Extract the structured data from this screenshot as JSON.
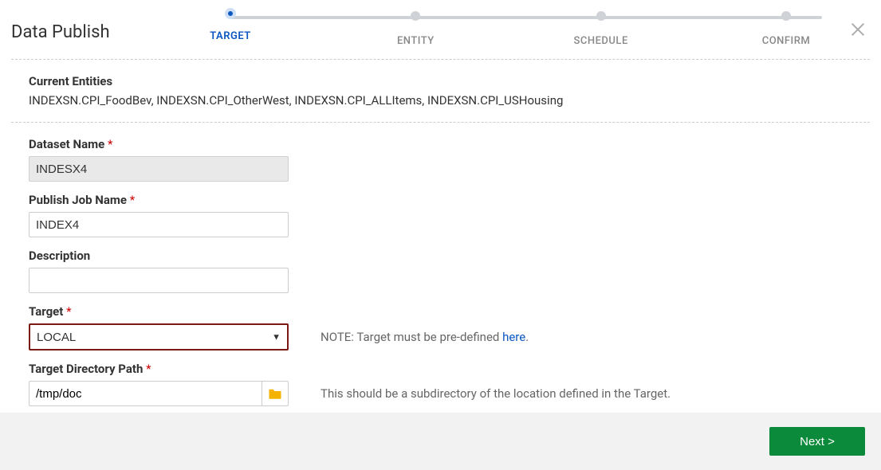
{
  "title": "Data Publish",
  "steps": [
    "TARGET",
    "ENTITY",
    "SCHEDULE",
    "CONFIRM"
  ],
  "activeStep": 0,
  "entities": {
    "label": "Current Entities",
    "value": "INDEXSN.CPI_FoodBev, INDEXSN.CPI_OtherWest, INDEXSN.CPI_ALLItems, INDEXSN.CPI_USHousing"
  },
  "form": {
    "datasetName": {
      "label": "Dataset Name",
      "required": true,
      "value": "INDESX4"
    },
    "publishJobName": {
      "label": "Publish Job Name",
      "required": true,
      "value": "INDEX4"
    },
    "description": {
      "label": "Description",
      "required": false,
      "value": ""
    },
    "target": {
      "label": "Target",
      "required": true,
      "value": "LOCAL",
      "notePrefix": "NOTE: Target must be pre-defined ",
      "noteLink": "here",
      "noteSuffix": "."
    },
    "targetDirectoryPath": {
      "label": "Target Directory Path",
      "required": true,
      "value": "/tmp/doc",
      "hint": "This should be a subdirectory of the location defined in the Target."
    }
  },
  "footer": {
    "nextLabel": "Next >"
  }
}
